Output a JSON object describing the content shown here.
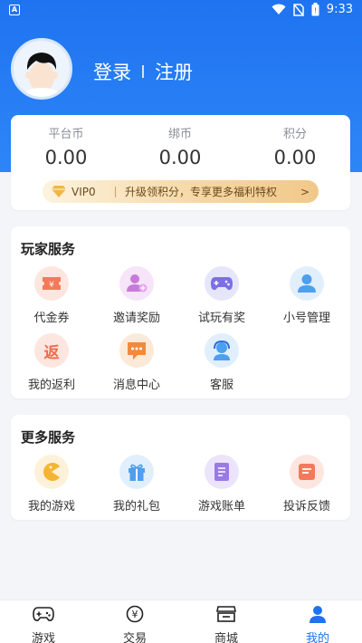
{
  "status": {
    "time": "9:33"
  },
  "user": {
    "login_label": "登录",
    "register_label": "注册"
  },
  "wallet": {
    "platform_coin": {
      "label": "平台币",
      "value": "0.00"
    },
    "bound_coin": {
      "label": "绑币",
      "value": "0.00"
    },
    "points": {
      "label": "积分",
      "value": "0.00"
    }
  },
  "vip": {
    "level": "VIP0",
    "promo": "升级领积分，专享更多福利特权",
    "arrow": ">"
  },
  "player_services": {
    "title": "玩家服务",
    "items": [
      {
        "label": "代金券",
        "icon": "voucher-icon"
      },
      {
        "label": "邀请奖励",
        "icon": "invite-user-icon"
      },
      {
        "label": "试玩有奖",
        "icon": "gamepad-icon"
      },
      {
        "label": "小号管理",
        "icon": "user-icon"
      },
      {
        "label": "我的返利",
        "icon": "rebate-icon",
        "glyph": "返"
      },
      {
        "label": "消息中心",
        "icon": "message-icon"
      },
      {
        "label": "客服",
        "icon": "customer-service-icon"
      }
    ]
  },
  "more_services": {
    "title": "更多服务",
    "items": [
      {
        "label": "我的游戏",
        "icon": "pacman-icon"
      },
      {
        "label": "我的礼包",
        "icon": "gift-icon"
      },
      {
        "label": "游戏账单",
        "icon": "bill-icon"
      },
      {
        "label": "投诉反馈",
        "icon": "feedback-icon"
      }
    ]
  },
  "tabs": [
    {
      "label": "游戏",
      "icon": "gamepad-tab-icon",
      "active": false
    },
    {
      "label": "交易",
      "icon": "trade-tab-icon",
      "glyph": "¥",
      "active": false
    },
    {
      "label": "商城",
      "icon": "store-tab-icon",
      "active": false
    },
    {
      "label": "我的",
      "icon": "profile-tab-icon",
      "active": true
    }
  ],
  "colors": {
    "primary": "#1f73f0",
    "vip_gold": "#f1c88a"
  }
}
